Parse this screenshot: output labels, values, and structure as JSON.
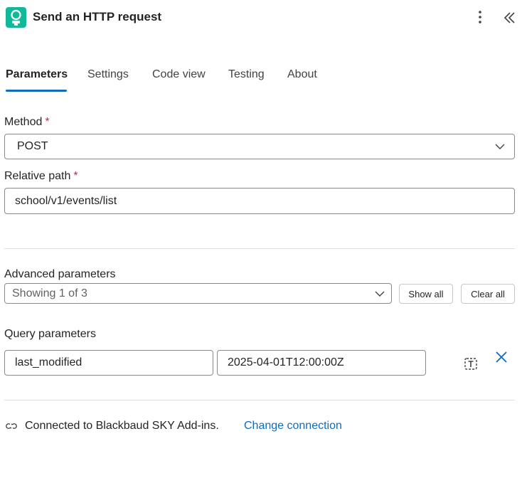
{
  "header": {
    "title": "Send an HTTP request",
    "icons": {
      "app": "blackbaud-connector-icon",
      "more": "more-vertical-icon",
      "collapse": "double-chevron-left-icon"
    }
  },
  "tabs": [
    {
      "label": "Parameters",
      "active": true
    },
    {
      "label": "Settings",
      "active": false
    },
    {
      "label": "Code view",
      "active": false
    },
    {
      "label": "Testing",
      "active": false
    },
    {
      "label": "About",
      "active": false
    }
  ],
  "method": {
    "label": "Method",
    "required_mark": "*",
    "value": "POST"
  },
  "relative_path": {
    "label": "Relative path",
    "required_mark": "*",
    "value": "school/v1/events/list"
  },
  "advanced": {
    "label": "Advanced parameters",
    "dropdown_value": "Showing 1 of 3",
    "show_all_label": "Show all",
    "clear_all_label": "Clear all"
  },
  "query": {
    "label": "Query parameters",
    "key": "last_modified",
    "value": "2025-04-01T12:00:00Z"
  },
  "connection": {
    "text": "Connected to Blackbaud SKY Add-ins.",
    "change_label": "Change connection"
  },
  "colors": {
    "accent": "#0f6cbd",
    "required": "#c4314b",
    "app_icon": "#12b89a"
  }
}
